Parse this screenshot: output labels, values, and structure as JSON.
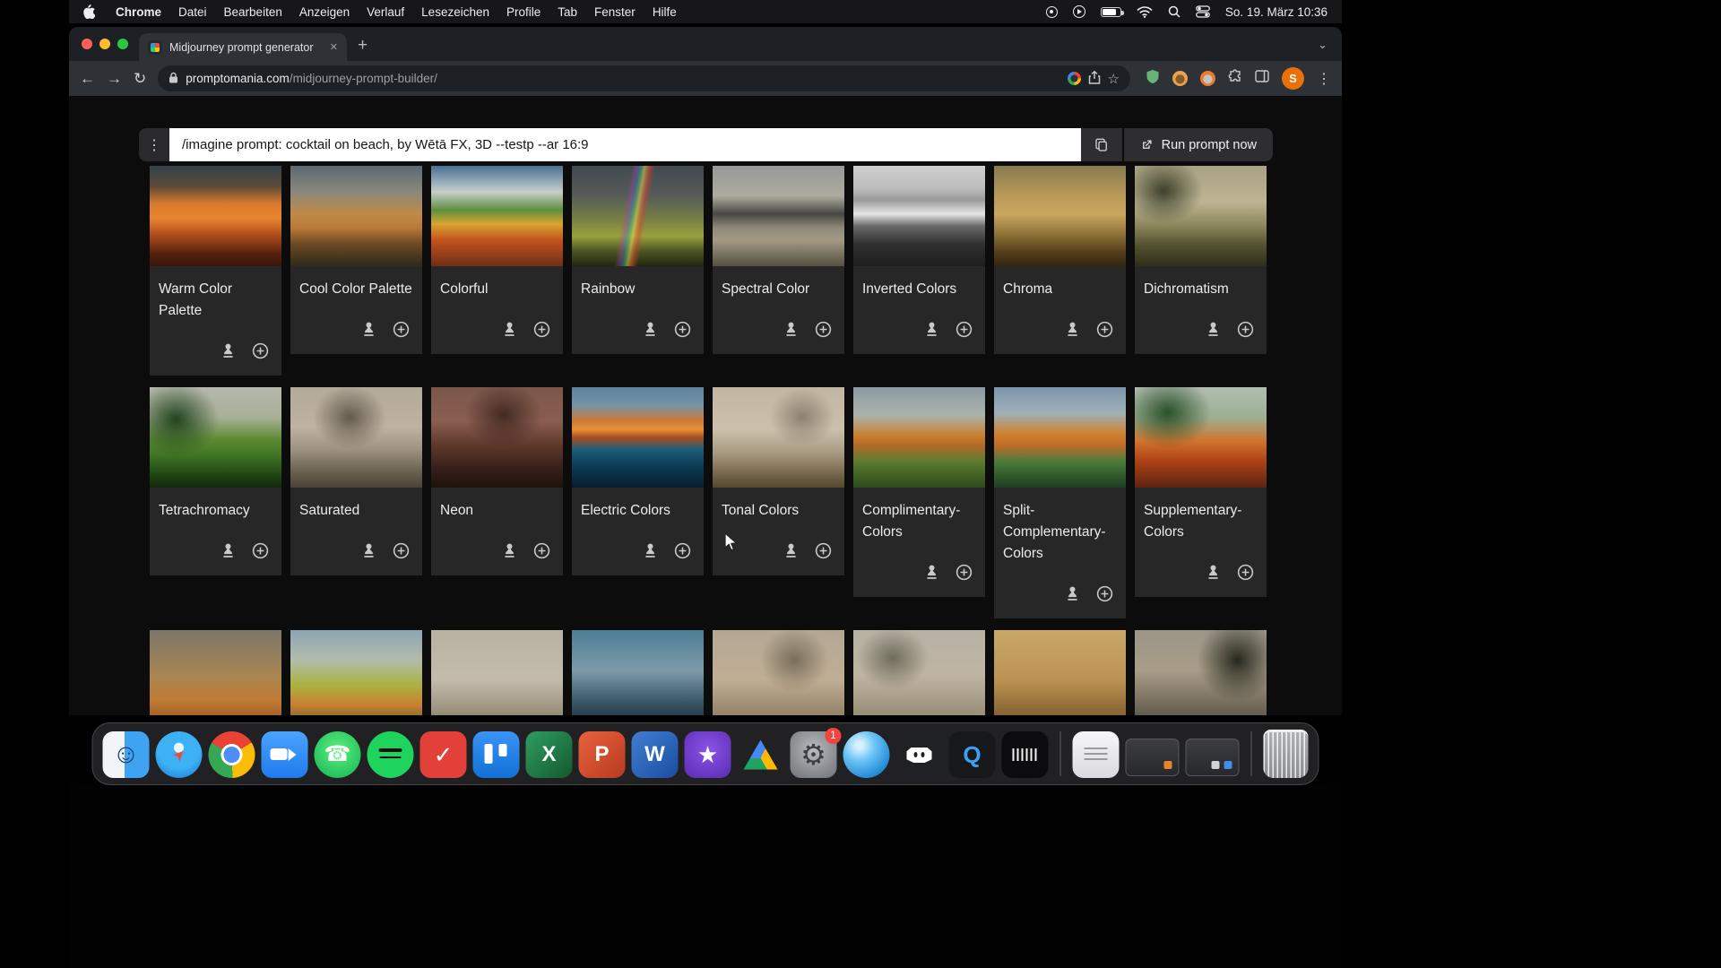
{
  "menubar": {
    "app_name": "Chrome",
    "items": [
      "Datei",
      "Bearbeiten",
      "Anzeigen",
      "Verlauf",
      "Lesezeichen",
      "Profile",
      "Tab",
      "Fenster",
      "Hilfe"
    ],
    "status_icons": [
      "screen-recording-indicator",
      "screen-mirroring-icon",
      "battery-icon",
      "wifi-icon",
      "spotlight-search-icon",
      "control-center-icon"
    ],
    "clock": "So. 19. März 10:36"
  },
  "browser": {
    "tab": {
      "title": "Midjourney prompt generator"
    },
    "url": {
      "domain": "promptomania.com",
      "path": "/midjourney-prompt-builder/"
    },
    "avatar_letter": "S",
    "toolbar_icons": [
      "back-icon",
      "forward-icon",
      "reload-icon",
      "lock-icon",
      "google-icon",
      "share-icon",
      "bookmark-star-icon",
      "shield-extension-icon",
      "tampermonkey-icon",
      "extension-orange-icon",
      "extensions-puzzle-icon",
      "side-panel-icon",
      "profile-avatar",
      "menu-kebab-icon"
    ]
  },
  "prompt_bar": {
    "value": "/imagine prompt: cocktail on beach, by Wētā FX, 3D --testp --ar 16:9",
    "run_label": "Run prompt now",
    "icons": [
      "kebab-icon",
      "copy-icon",
      "external-link-icon"
    ]
  },
  "accent_colors": {
    "run_bar_bg": "#2e2e30",
    "page_bg": "#0c0c0d",
    "card_bg": "#272727",
    "avatar_orange": "#e8710a",
    "badge_red": "#f1453d"
  },
  "cards": [
    {
      "label": "Warm Color Palette",
      "bg": "linear-gradient(180deg,#33424a 0%,#5a4a38 20%,#d97b2c 38%,#e8862e 52%,#b34f1c 68%,#54200e 88%,#3a150a 100%)"
    },
    {
      "label": "Cool Color Palette",
      "bg": "linear-gradient(180deg,#5d6872 0%,#8b887c 26%,#c08a46 48%,#b97a36 62%,#6b4a24 78%,#2e2a1a 100%)"
    },
    {
      "label": "Colorful",
      "bg": "linear-gradient(180deg,#4a6f92 0%,#9fb3bd 18%,#c8cdc9 26%,#5d8f3e 44%,#d9a430 58%,#c2541d 74%,#6e2f14 100%)"
    },
    {
      "label": "Rainbow",
      "bg": "linear-gradient(100deg,transparent 40%,rgba(180,60,180,.35) 43%,rgba(60,120,220,.4) 45%,rgba(80,200,120,.45) 47%,rgba(240,230,80,.5) 49%,rgba(240,120,50,.5) 51%,rgba(220,60,50,.45) 53%,transparent 56%),linear-gradient(180deg,#42494e 0%,#565c58 30%,#7a8244 55%,#9aa03c 70%,#4c5524 85%,#23250f 100%)"
    },
    {
      "label": "Spectral Color",
      "bg": "linear-gradient(180deg,#97999a 0%,#adab9f 30%,#474743 48%,#8f8a7a 62%,#a39a86 74%,#54503f 100%)"
    },
    {
      "label": "Inverted Colors",
      "bg": "linear-gradient(180deg,#cfcfcf 0%,#bdbdbd 22%,#9a9a9a 34%,#e6e6e6 48%,#6a6a6a 60%,#2f2f2f 78%,#1f1f1f 100%)"
    },
    {
      "label": "Chroma",
      "bg": "linear-gradient(180deg,#8a7a50 0%,#b99a58 30%,#caa75f 48%,#8f7238 68%,#5a431e 84%,#33250f 100%)"
    },
    {
      "label": "Dichromatism",
      "bg": "radial-gradient(ellipse 45% 50% at 22% 25%, rgba(40,45,25,.85), transparent 65%),linear-gradient(180deg,#a8a183 0%,#bcb492 36%,#8f8a60 58%,#565432 78%,#2e2d18 100%)"
    },
    {
      "label": "Tetrachromacy",
      "bg": "radial-gradient(ellipse 48% 55% at 20% 32%, rgba(26,62,24,.95), transparent 68%),linear-gradient(180deg,#b5b8ab 0%,#a9b098 30%,#5d8a33 52%,#3f7423 68%,#1e4413 88%,#12290c 100%)"
    },
    {
      "label": "Saturated",
      "bg": "radial-gradient(ellipse 42% 48% at 45% 30%, rgba(70,62,50,.75), transparent 66%),linear-gradient(180deg,#b3aa9a 0%,#beb2a0 40%,#9d9280 62%,#6f6554 82%,#4a4236 100%)"
    },
    {
      "label": "Neon",
      "bg": "radial-gradient(ellipse 45% 50% at 55% 28%, rgba(40,20,16,.7), transparent 65%),linear-gradient(180deg,#7c564a 0%,#8a5e50 34%,#5e382c 58%,#38201a 80%,#1f110c 100%)"
    },
    {
      "label": "Electric Colors",
      "bg": "linear-gradient(180deg,#5d82a0 0%,#7793a6 18%,#d07a33 34%,#e8903a 42%,#a84e1e 50%,#1d5d7c 62%,#0d3c55 78%,#071f2e 100%)"
    },
    {
      "label": "Tonal Colors",
      "bg": "radial-gradient(ellipse 38% 45% at 68% 30%, rgba(90,80,62,.55), transparent 65%),linear-gradient(180deg,#c2b6a2 0%,#ccc0ac 42%,#ab9c84 64%,#7c6c52 84%,#55462f 100%)"
    },
    {
      "label": "Complimentary-Colors",
      "bg": "linear-gradient(180deg,#8d9aa2 0%,#aab3ad 28%,#c9802f 48%,#b06a26 58%,#5d7c30 74%,#2c4a1a 100%)"
    },
    {
      "label": "Split-Complementary-Colors",
      "bg": "linear-gradient(180deg,#7d95ab 0%,#9fb0b8 26%,#cf8231 46%,#c06c28 58%,#4b7c3a 74%,#1d3e22 100%)"
    },
    {
      "label": "Supplementary-Colors",
      "bg": "radial-gradient(ellipse 50% 55% at 25% 25%, rgba(30,70,30,.9), transparent 66%),linear-gradient(180deg,#b2bcb2 0%,#9cb093 30%,#d0742c 54%,#b04418 72%,#5e2410 100%)"
    }
  ],
  "partial_cards": [
    {
      "label": "",
      "bg": "linear-gradient(180deg,#7d7668 0%,#a88652 45%,#c07a34 70%,#8a4c1c 100%)"
    },
    {
      "label": "",
      "bg": "linear-gradient(180deg,#8da4b5 0%,#b3bcab 30%,#aab23f 55%,#c97e30 75%,#3e5c2a 100%)"
    },
    {
      "label": "",
      "bg": "linear-gradient(180deg,#b9b1a1 0%,#c3bbab 50%,#9c9280 80%,#6f6450 100%)"
    },
    {
      "label": "",
      "bg": "linear-gradient(180deg,#4c7d95 0%,#7d9aaa 40%,#3c5a6c 70%,#14222c 100%)"
    },
    {
      "label": "",
      "bg": "radial-gradient(ellipse 40% 50% at 62% 30%, rgba(80,70,55,.6), transparent 65%),linear-gradient(180deg,#b4a793 0%,#bfae94 50%,#806f54 100%)"
    },
    {
      "label": "",
      "bg": "radial-gradient(ellipse 42% 48% at 30% 28%, rgba(60,60,45,.6), transparent 65%),linear-gradient(180deg,#b8b2a4 0%,#beb4a2 45%,#8a8068 100%)"
    },
    {
      "label": "",
      "bg": "linear-gradient(180deg,#c9a968 0%,#bb9252 50%,#6e4e22 100%)"
    },
    {
      "label": "",
      "bg": "radial-gradient(ellipse 45% 60% at 78% 30%, rgba(25,28,18,.9), transparent 68%),linear-gradient(180deg,#9b9588 0%,#a89d88 40%,#4c463a 100%)"
    }
  ],
  "dock": {
    "items": [
      {
        "name": "finder-icon",
        "glyph": "☺"
      },
      {
        "name": "safari-icon",
        "glyph": "➤"
      },
      {
        "name": "chrome-icon",
        "glyph": ""
      },
      {
        "name": "zoom-icon",
        "glyph": ""
      },
      {
        "name": "whatsapp-icon",
        "glyph": "☎"
      },
      {
        "name": "spotify-icon",
        "glyph": ""
      },
      {
        "name": "todoist-icon",
        "glyph": "✓"
      },
      {
        "name": "trello-icon",
        "glyph": ""
      },
      {
        "name": "excel-icon",
        "glyph": "X"
      },
      {
        "name": "powerpoint-icon",
        "glyph": "P"
      },
      {
        "name": "word-icon",
        "glyph": "W"
      },
      {
        "name": "imovie-icon",
        "glyph": "★"
      },
      {
        "name": "google-drive-icon",
        "glyph": ""
      },
      {
        "name": "system-settings-icon",
        "glyph": "⚙",
        "badge": "1"
      },
      {
        "name": "blue-sphere-icon",
        "glyph": ""
      },
      {
        "name": "discord-icon",
        "glyph": ""
      },
      {
        "name": "quicktime-icon",
        "glyph": "Q"
      },
      {
        "name": "voice-memos-icon",
        "glyph": ""
      },
      {
        "type": "sep"
      },
      {
        "name": "white-window-app-icon",
        "glyph": ""
      },
      {
        "name": "minimized-window-1",
        "glyph": ""
      },
      {
        "name": "minimized-window-2",
        "glyph": ""
      },
      {
        "type": "sep"
      },
      {
        "name": "trash-icon",
        "glyph": ""
      }
    ]
  }
}
